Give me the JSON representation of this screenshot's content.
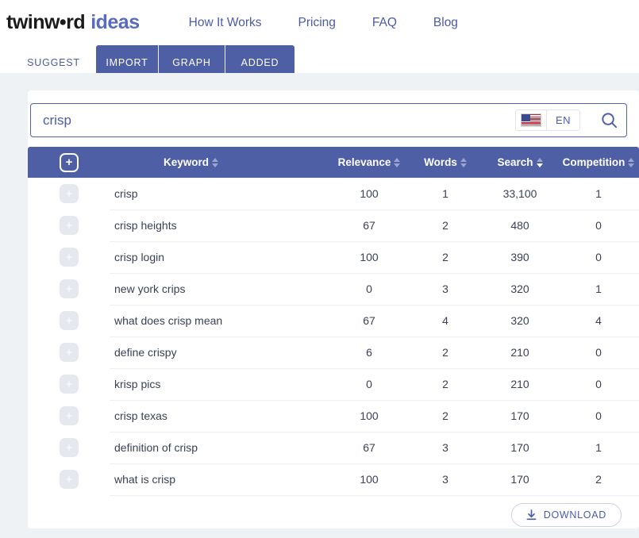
{
  "brand": {
    "logo_dark": "twinw•rd",
    "logo_accent": "ideas"
  },
  "nav": {
    "links": [
      {
        "label": "How It Works"
      },
      {
        "label": "Pricing"
      },
      {
        "label": "FAQ"
      },
      {
        "label": "Blog"
      }
    ]
  },
  "tabs": [
    {
      "label": "SUGGEST",
      "active": true
    },
    {
      "label": "IMPORT",
      "active": false
    },
    {
      "label": "GRAPH",
      "active": false
    },
    {
      "label": "ADDED",
      "active": false
    }
  ],
  "search": {
    "value": "crisp",
    "placeholder": "Enter a keyword",
    "language_code": "EN",
    "flag_icon": "us-flag-icon",
    "search_icon": "search-icon"
  },
  "table": {
    "add_all_icon": "plus-icon",
    "columns": [
      {
        "key": "keyword",
        "label": "Keyword",
        "sort": "none"
      },
      {
        "key": "relevance",
        "label": "Relevance",
        "sort": "none"
      },
      {
        "key": "words",
        "label": "Words",
        "sort": "none"
      },
      {
        "key": "search",
        "label": "Search",
        "sort": "desc"
      },
      {
        "key": "competition",
        "label": "Competition",
        "sort": "none"
      }
    ],
    "rows": [
      {
        "keyword": "crisp",
        "relevance": "100",
        "words": "1",
        "search": "33,100",
        "competition": "1"
      },
      {
        "keyword": "crisp heights",
        "relevance": "67",
        "words": "2",
        "search": "480",
        "competition": "0"
      },
      {
        "keyword": "crisp login",
        "relevance": "100",
        "words": "2",
        "search": "390",
        "competition": "0"
      },
      {
        "keyword": "new york crips",
        "relevance": "0",
        "words": "3",
        "search": "320",
        "competition": "1"
      },
      {
        "keyword": "what does crisp mean",
        "relevance": "67",
        "words": "4",
        "search": "320",
        "competition": "4"
      },
      {
        "keyword": "define crispy",
        "relevance": "6",
        "words": "2",
        "search": "210",
        "competition": "0"
      },
      {
        "keyword": "krisp pics",
        "relevance": "0",
        "words": "2",
        "search": "210",
        "competition": "0"
      },
      {
        "keyword": "crisp texas",
        "relevance": "100",
        "words": "2",
        "search": "170",
        "competition": "0"
      },
      {
        "keyword": "definition of crisp",
        "relevance": "67",
        "words": "3",
        "search": "170",
        "competition": "1"
      },
      {
        "keyword": "what is crisp",
        "relevance": "100",
        "words": "3",
        "search": "170",
        "competition": "2"
      }
    ],
    "row_add_icon": "plus-icon"
  },
  "footer": {
    "download_label": "DOWNLOAD",
    "download_icon": "download-icon"
  },
  "colors": {
    "brand_indigo": "#4f5fa5",
    "link_indigo": "#4b5ba6",
    "page_bg": "#eef2f5"
  }
}
